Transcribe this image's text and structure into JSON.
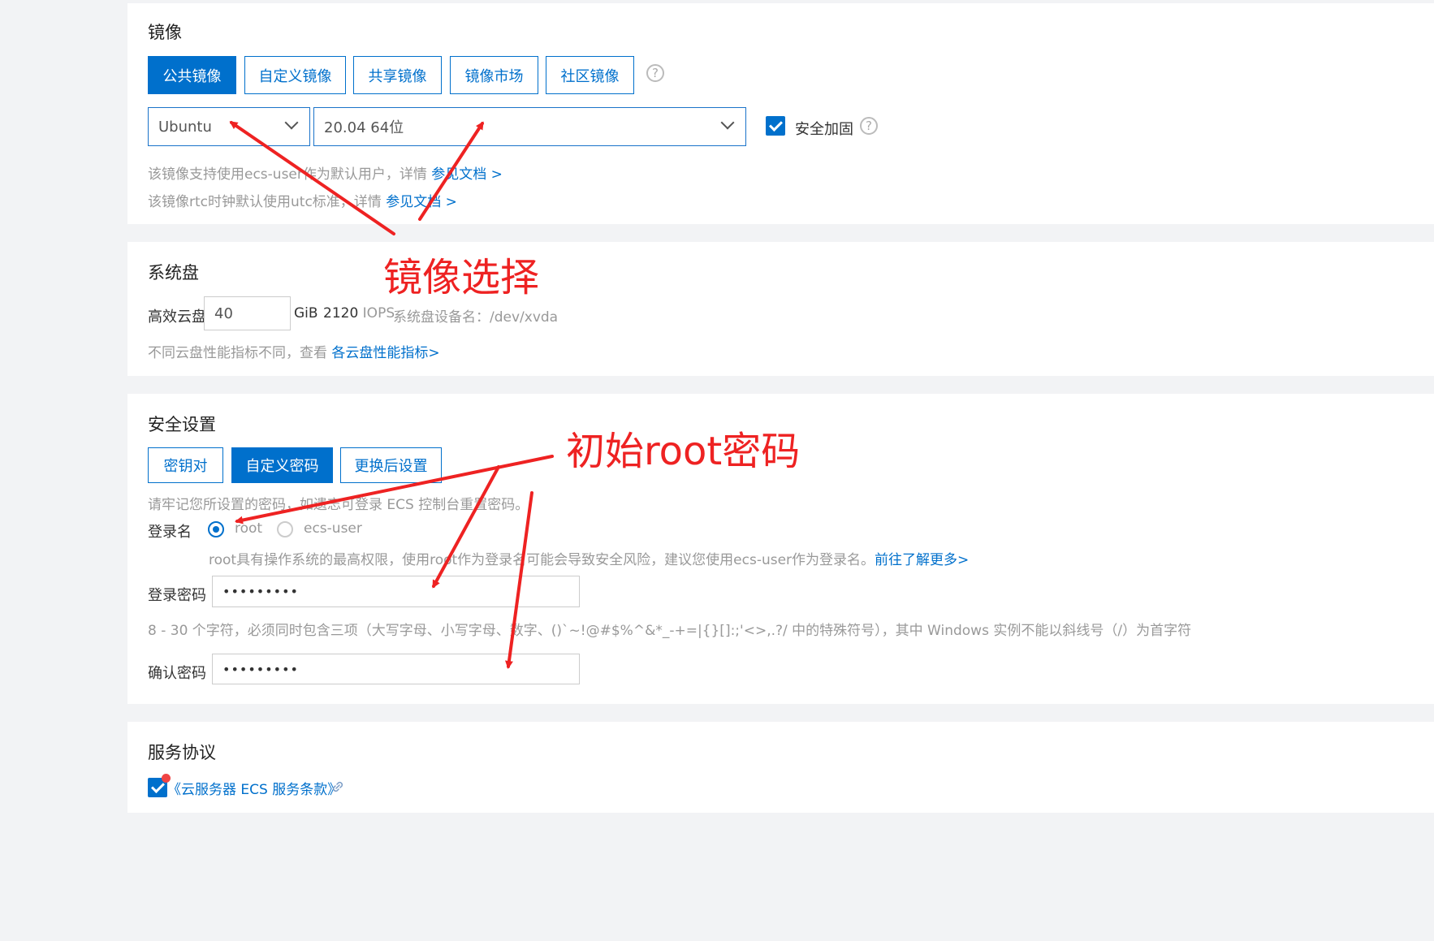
{
  "image_section": {
    "title": "镜像",
    "tabs": [
      "公共镜像",
      "自定义镜像",
      "共享镜像",
      "镜像市场",
      "社区镜像"
    ],
    "active_tab": "公共镜像",
    "os_select": "Ubuntu",
    "version_select": "20.04 64位",
    "security_harden": {
      "label": "安全加固",
      "checked": true
    },
    "hint1": {
      "text": "该镜像支持使用ecs-user作为默认用户，详情 ",
      "link": "参见文档 >"
    },
    "hint2": {
      "text": "该镜像rtc时钟默认使用utc标准，详情 ",
      "link": "参见文档 >"
    }
  },
  "system_disk": {
    "title": "系统盘",
    "disk_type": "高效云盘",
    "size": "40",
    "unit": "GiB",
    "iops_value": "2120",
    "iops_label": "IOPS",
    "device_name": "系统盘设备名：/dev/xvda",
    "hint": "不同云盘性能指标不同，查看 ",
    "hint_link": "各云盘性能指标>"
  },
  "security": {
    "title": "安全设置",
    "tabs": [
      "密钥对",
      "自定义密码",
      "更换后设置"
    ],
    "active_tab": "自定义密码",
    "note": "请牢记您所设置的密码，如遗忘可登录 ECS 控制台重置密码。",
    "login_label": "登录名",
    "login_options": [
      "root",
      "ecs-user"
    ],
    "login_selected": "root",
    "root_warning": "root具有操作系统的最高权限，使用root作为登录名可能会导致安全风险，建议您使用ecs-user作为登录名。",
    "root_warning_link": "前往了解更多>",
    "password_label": "登录密码",
    "password_value": "•••••••••",
    "password_rule": "8 - 30 个字符，必须同时包含三项（大写字母、小写字母、数字、()`~!@#$%^&*_-+=|{}[]:;'<>,.?/ 中的特殊符号），其中 Windows 实例不能以斜线号（/）为首字符",
    "confirm_label": "确认密码",
    "confirm_value": "•••••••••"
  },
  "agreement": {
    "title": "服务协议",
    "link": "《云服务器 ECS 服务条款》",
    "checked": true
  },
  "annotations": {
    "image_choice": "镜像选择",
    "root_password": "初始root密码"
  },
  "colors": {
    "accent": "#0070cc",
    "annotation": "#ee2222",
    "page_bg": "#f2f3f5"
  }
}
